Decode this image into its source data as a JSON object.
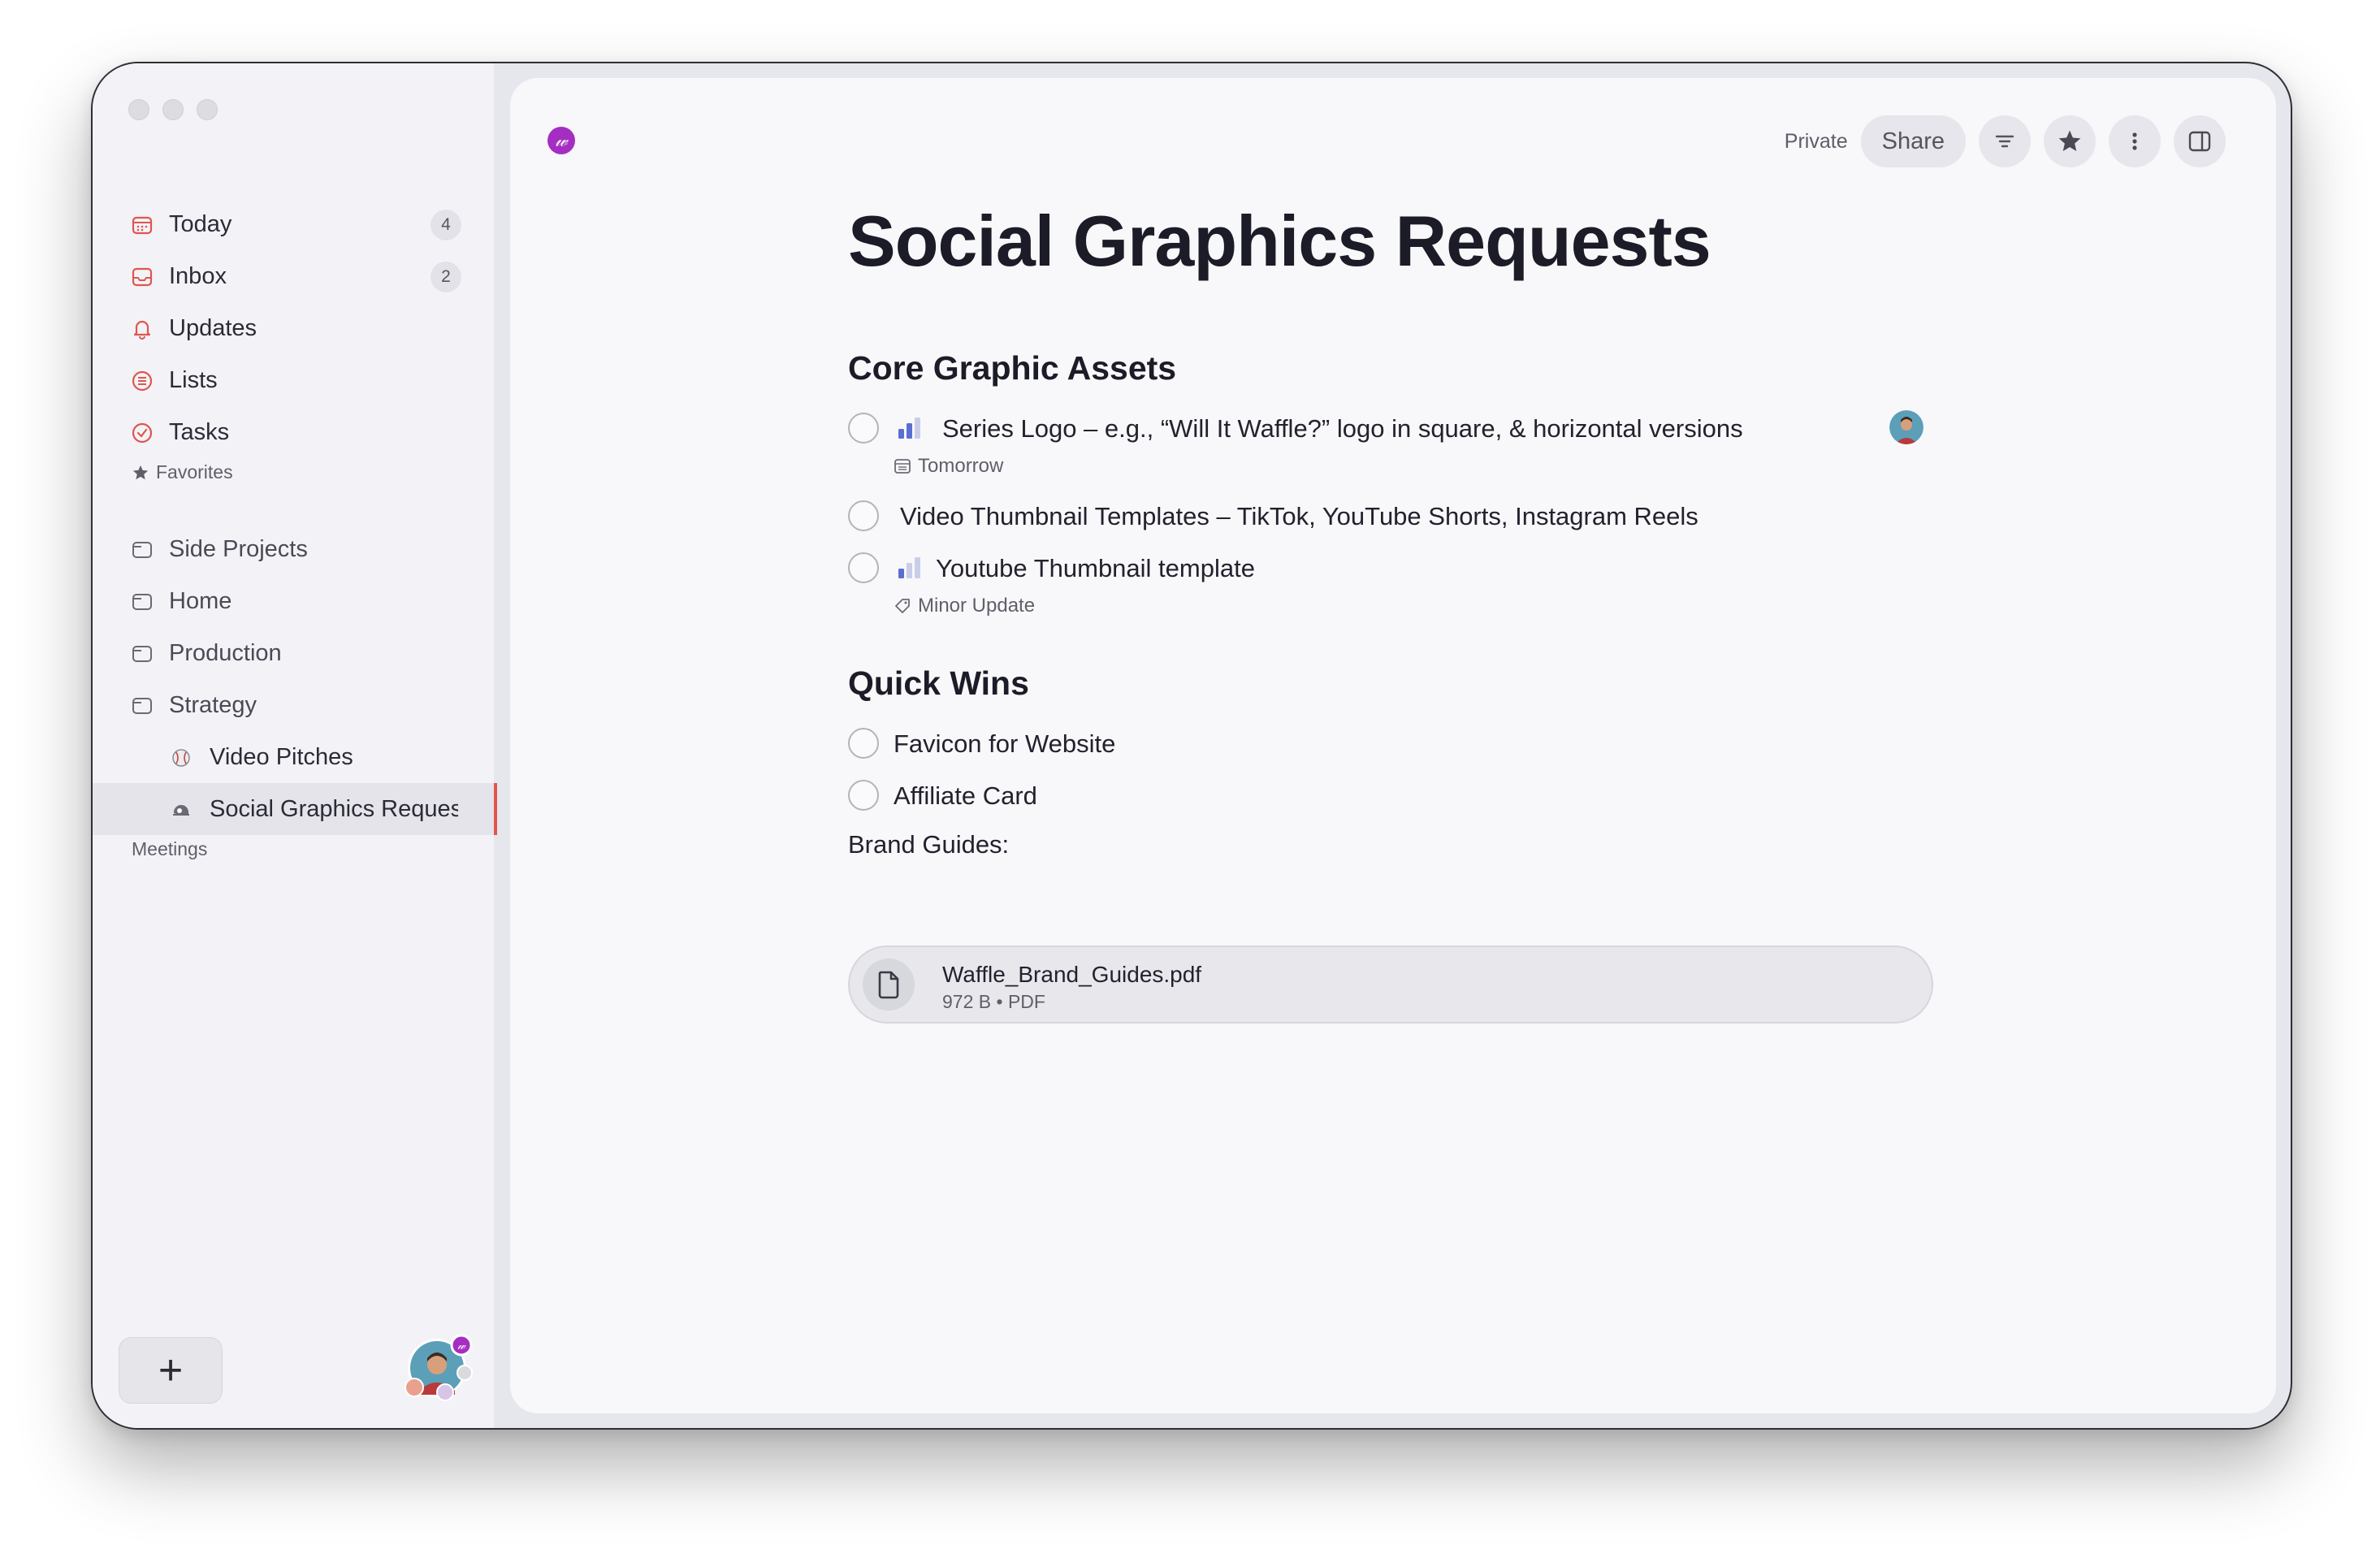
{
  "sidebar": {
    "nav": [
      {
        "label": "Today",
        "badge": "4",
        "icon": "calendar-icon"
      },
      {
        "label": "Inbox",
        "badge": "2",
        "icon": "inbox-icon"
      },
      {
        "label": "Updates",
        "icon": "bell-icon"
      },
      {
        "label": "Lists",
        "icon": "list-icon"
      },
      {
        "label": "Tasks",
        "icon": "check-circle-icon"
      }
    ],
    "favorites_label": "Favorites",
    "favorites": [
      {
        "label": "Side Projects",
        "icon": "folder-icon"
      },
      {
        "label": "Home",
        "icon": "folder-icon"
      },
      {
        "label": "Production",
        "icon": "folder-icon"
      },
      {
        "label": "Strategy",
        "icon": "folder-icon"
      },
      {
        "label": "Video Pitches",
        "icon": "baseball-icon"
      },
      {
        "label": "Social Graphics Reques",
        "icon": "helmet-icon"
      }
    ],
    "meetings_label": "Meetings",
    "add_button": "+"
  },
  "topbar": {
    "workspace_logo": "𝓌",
    "privacy": "Private",
    "share_label": "Share"
  },
  "page": {
    "title": "Social Graphics Requests",
    "sections": [
      {
        "heading": "Core Graphic Assets"
      },
      {
        "heading": "Quick Wins"
      }
    ],
    "tasks": [
      {
        "text": "Series Logo – e.g., “Will It Waffle?” logo in square, & horizontal versions",
        "meta": "Tomorrow",
        "priority": "medium"
      },
      {
        "text": "Video Thumbnail Templates – TikTok, YouTube Shorts, Instagram Reels"
      },
      {
        "text": "Youtube Thumbnail template",
        "meta": "Minor Update",
        "priority": "low"
      },
      {
        "text": "Favicon for Website"
      },
      {
        "text": "Affiliate Card"
      }
    ],
    "brand_label": "Brand Guides:",
    "attachment": {
      "name": "Waffle_Brand_Guides.pdf",
      "meta": "972 B • PDF"
    }
  },
  "colors": {
    "accent_red": "#e0564e",
    "priority_blue": "#5a6fd1",
    "workspace_purple": "#a42ec2"
  }
}
